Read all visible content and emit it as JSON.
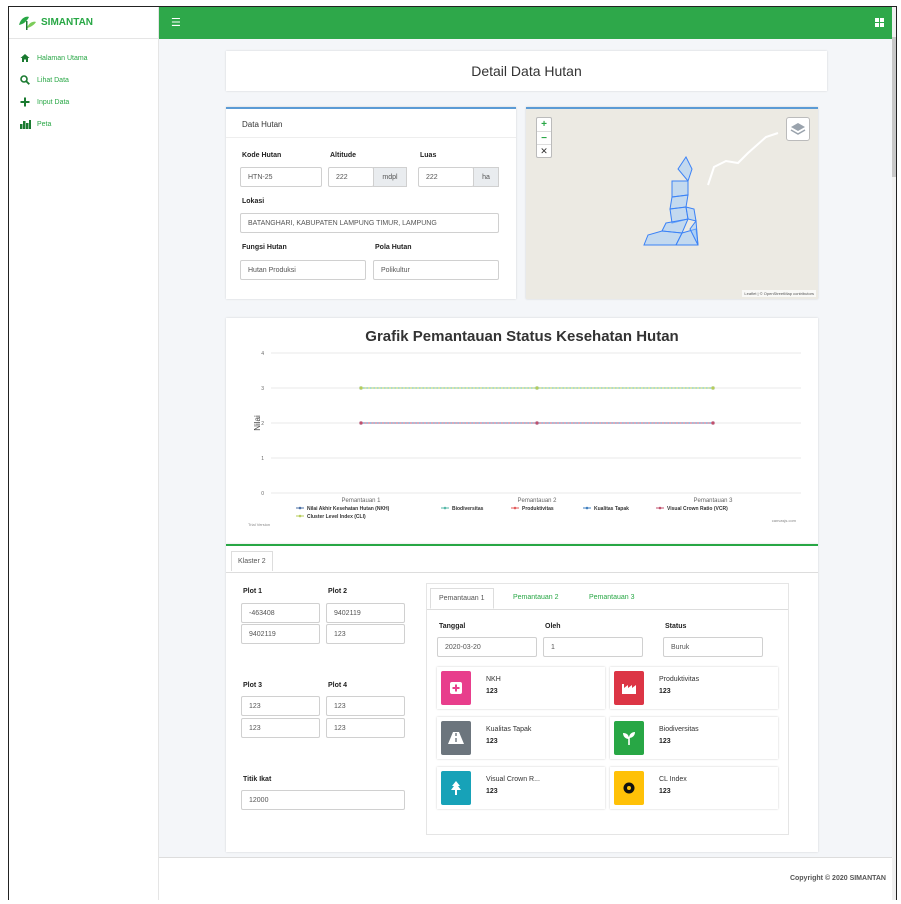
{
  "app": {
    "brand": "SIMANTAN"
  },
  "sidebar": {
    "items": [
      {
        "label": "Halaman Utama",
        "icon": "home-icon"
      },
      {
        "label": "Lihat Data",
        "icon": "search-icon"
      },
      {
        "label": "Input Data",
        "icon": "plus-icon"
      },
      {
        "label": "Peta",
        "icon": "map-icon"
      }
    ]
  },
  "page": {
    "title": "Detail Data Hutan"
  },
  "data_hutan": {
    "header": "Data Hutan",
    "kode_label": "Kode Hutan",
    "kode_value": "HTN-25",
    "altitude_label": "Altitude",
    "altitude_value": "222",
    "altitude_unit": "mdpl",
    "luas_label": "Luas",
    "luas_value": "222",
    "luas_unit": "ha",
    "lokasi_label": "Lokasi",
    "lokasi_value": "BATANGHARI, KABUPATEN LAMPUNG TIMUR, LAMPUNG",
    "fungsi_label": "Fungsi Hutan",
    "fungsi_value": "Hutan Produksi",
    "pola_label": "Pola Hutan",
    "pola_value": "Polikultur"
  },
  "map": {
    "zoom_in": "+",
    "zoom_out": "−",
    "fullscreen": "✕",
    "attribution": "Leaflet | © OpenStreetMap contributors",
    "polygon_color": "#3b82f6"
  },
  "chart_data": {
    "type": "line",
    "title": "Grafik Pemantauan Status Kesehatan Hutan",
    "ylabel": "Nilai",
    "categories": [
      "Pemantauan 1",
      "Pemantauan 2",
      "Pemantauan 3"
    ],
    "ylim": [
      0,
      4
    ],
    "yticks": [
      "0",
      "1",
      "2",
      "3",
      "4"
    ],
    "grid": true,
    "legend_position": "bottom",
    "series": [
      {
        "name": "Nilai Akhir Kesehatan Hutan (NKH)",
        "values": [
          3,
          3,
          3
        ],
        "color": "#4a6fa5"
      },
      {
        "name": "Biodiversitas",
        "values": [
          3,
          3,
          3
        ],
        "color": "#56b8a8"
      },
      {
        "name": "Produktivitas",
        "values": [
          2,
          2,
          2
        ],
        "color": "#e35b5b"
      },
      {
        "name": "Kualitas Tapak",
        "values": [
          2,
          2,
          2
        ],
        "color": "#3f7fbf"
      },
      {
        "name": "Visual Crown Ratio (VCR)",
        "values": [
          2,
          2,
          2
        ],
        "color": "#c0506d"
      },
      {
        "name": "Cluster Level Index (CLI)",
        "values": [
          3,
          3,
          3
        ],
        "color": "#b7cc5a"
      }
    ],
    "watermark_left": "Trial Version",
    "watermark_right": "canvasjs.com"
  },
  "klaster": {
    "tab": "Klaster 2",
    "plot1_label": "Plot 1",
    "plot1_a": "-463408",
    "plot1_b": "9402119",
    "plot2_label": "Plot 2",
    "plot2_a": "9402119",
    "plot2_b": "123",
    "plot3_label": "Plot 3",
    "plot3_a": "123",
    "plot3_b": "123",
    "plot4_label": "Plot 4",
    "plot4_a": "123",
    "plot4_b": "123",
    "titik_label": "Titik Ikat",
    "titik_value": "12000"
  },
  "pemantauan": {
    "tabs": [
      "Pemantauan 1",
      "Pemantauan 2",
      "Pemantauan 3"
    ],
    "tanggal_label": "Tanggal",
    "tanggal_value": "2020-03-20",
    "oleh_label": "Oleh",
    "oleh_value": "1",
    "status_label": "Status",
    "status_value": "Buruk",
    "boxes": [
      {
        "title": "NKH",
        "value": "123",
        "color": "#e83e8c",
        "icon": "plus-square-icon"
      },
      {
        "title": "Produktivitas",
        "value": "123",
        "color": "#dc3545",
        "icon": "factory-icon"
      },
      {
        "title": "Kualitas Tapak",
        "value": "123",
        "color": "#6c757d",
        "icon": "road-icon"
      },
      {
        "title": "Biodiversitas",
        "value": "123",
        "color": "#28a745",
        "icon": "seedling-icon"
      },
      {
        "title": "Visual Crown R...",
        "value": "123",
        "color": "#17a2b8",
        "icon": "tree-icon"
      },
      {
        "title": "CL Index",
        "value": "123",
        "color": "#ffc107",
        "icon": "circle-icon"
      }
    ]
  },
  "footer": {
    "copyright": "Copyright © 2020 SIMANTAN"
  }
}
